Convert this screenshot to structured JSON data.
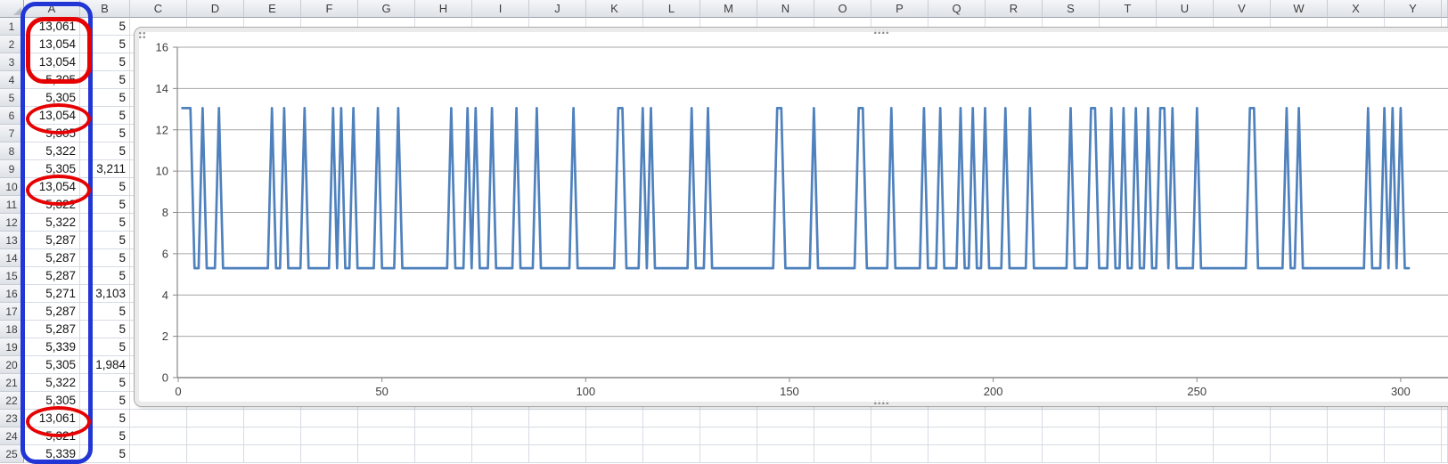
{
  "sheet": {
    "columns": [
      "A",
      "B",
      "C",
      "D",
      "E",
      "F",
      "G",
      "H",
      "I",
      "J",
      "K",
      "L",
      "M",
      "N",
      "O",
      "P",
      "Q",
      "R",
      "S",
      "T",
      "U",
      "V",
      "W",
      "X",
      "Y"
    ],
    "rows": [
      {
        "n": "1",
        "a": "13,061",
        "b": "5"
      },
      {
        "n": "2",
        "a": "13,054",
        "b": "5"
      },
      {
        "n": "3",
        "a": "13,054",
        "b": "5"
      },
      {
        "n": "4",
        "a": "5,305",
        "b": "5"
      },
      {
        "n": "5",
        "a": "5,305",
        "b": "5"
      },
      {
        "n": "6",
        "a": "13,054",
        "b": "5"
      },
      {
        "n": "7",
        "a": "5,305",
        "b": "5"
      },
      {
        "n": "8",
        "a": "5,322",
        "b": "5"
      },
      {
        "n": "9",
        "a": "5,305",
        "b": "3,211"
      },
      {
        "n": "10",
        "a": "13,054",
        "b": "5"
      },
      {
        "n": "11",
        "a": "5,322",
        "b": "5"
      },
      {
        "n": "12",
        "a": "5,322",
        "b": "5"
      },
      {
        "n": "13",
        "a": "5,287",
        "b": "5"
      },
      {
        "n": "14",
        "a": "5,287",
        "b": "5"
      },
      {
        "n": "15",
        "a": "5,287",
        "b": "5"
      },
      {
        "n": "16",
        "a": "5,271",
        "b": "3,103"
      },
      {
        "n": "17",
        "a": "5,287",
        "b": "5"
      },
      {
        "n": "18",
        "a": "5,287",
        "b": "5"
      },
      {
        "n": "19",
        "a": "5,339",
        "b": "5"
      },
      {
        "n": "20",
        "a": "5,305",
        "b": "1,984"
      },
      {
        "n": "21",
        "a": "5,322",
        "b": "5"
      },
      {
        "n": "22",
        "a": "5,305",
        "b": "5"
      },
      {
        "n": "23",
        "a": "13,061",
        "b": "5"
      },
      {
        "n": "24",
        "a": "5,321",
        "b": "5"
      },
      {
        "n": "25",
        "a": "5,339",
        "b": "5"
      }
    ]
  },
  "annotations": {
    "blue_box": {
      "range": "A1:A25",
      "color": "#2136D4"
    },
    "red_circles": {
      "ranges": [
        "A1:A3",
        "A6",
        "A10",
        "A23"
      ],
      "color": "#E60202"
    }
  },
  "chart_data": {
    "type": "line",
    "title": "",
    "xlabel": "",
    "ylabel": "",
    "legend": "none",
    "grid": "horizontal-major",
    "x_ticks": [
      0,
      50,
      100,
      150,
      200,
      250,
      300
    ],
    "y_ticks": [
      0,
      2,
      4,
      6,
      8,
      10,
      12,
      14,
      16
    ],
    "x_range": [
      0,
      305
    ],
    "y_range": [
      0,
      16
    ],
    "x_start": 1,
    "n_points": 302,
    "baseline_value": 5.3,
    "peak_value": 13.05,
    "spike_ranges": [
      [
        1,
        3
      ],
      [
        6,
        6
      ],
      [
        10,
        10
      ],
      [
        23,
        23
      ],
      [
        26,
        26
      ],
      [
        31,
        31
      ],
      [
        38,
        38
      ],
      [
        40,
        40
      ],
      [
        43,
        43
      ],
      [
        49,
        49
      ],
      [
        54,
        54
      ],
      [
        67,
        67
      ],
      [
        71,
        71
      ],
      [
        73,
        73
      ],
      [
        77,
        77
      ],
      [
        83,
        83
      ],
      [
        88,
        88
      ],
      [
        97,
        97
      ],
      [
        108,
        109
      ],
      [
        114,
        114
      ],
      [
        116,
        116
      ],
      [
        126,
        126
      ],
      [
        130,
        130
      ],
      [
        147,
        148
      ],
      [
        156,
        156
      ],
      [
        167,
        168
      ],
      [
        175,
        175
      ],
      [
        183,
        183
      ],
      [
        187,
        187
      ],
      [
        192,
        192
      ],
      [
        195,
        195
      ],
      [
        198,
        198
      ],
      [
        203,
        203
      ],
      [
        209,
        209
      ],
      [
        219,
        219
      ],
      [
        224,
        225
      ],
      [
        229,
        229
      ],
      [
        232,
        232
      ],
      [
        235,
        235
      ],
      [
        238,
        238
      ],
      [
        241,
        242
      ],
      [
        244,
        244
      ],
      [
        250,
        250
      ],
      [
        263,
        264
      ],
      [
        272,
        272
      ],
      [
        275,
        275
      ],
      [
        292,
        292
      ],
      [
        296,
        296
      ],
      [
        298,
        298
      ],
      [
        300,
        300
      ]
    ],
    "series_color": "#4F81BD",
    "gridline_color": "#A6A6A6",
    "axis_color": "#898989",
    "label_color": "#404040"
  }
}
